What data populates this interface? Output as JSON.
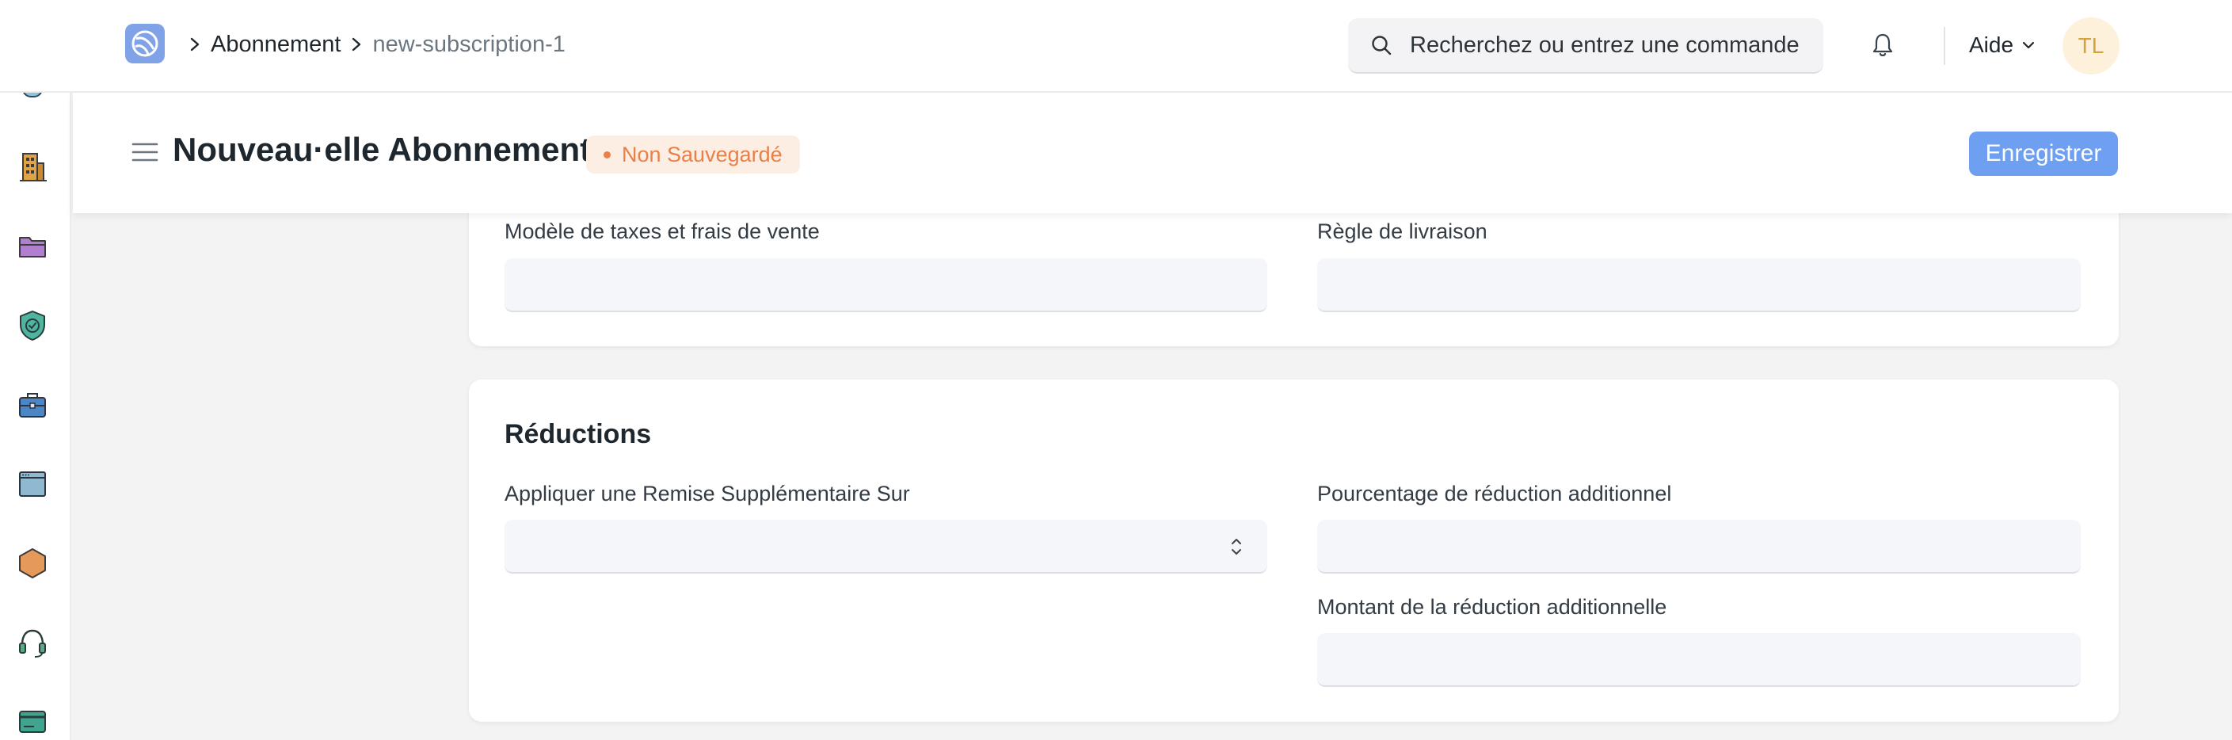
{
  "navbar": {
    "breadcrumbs": [
      "Abonnement",
      "new-subscription-1"
    ],
    "search_placeholder": "Recherchez ou entrez une commande",
    "help_label": "Aide",
    "avatar_initials": "TL"
  },
  "sidebar": {
    "icons": [
      "database-icon",
      "building-icon",
      "folder-icon",
      "shield-check-icon",
      "briefcase-icon",
      "window-icon",
      "hexagon-icon",
      "headset-icon",
      "card-icon"
    ]
  },
  "page": {
    "title": "Nouveau·elle Abonnement",
    "status": "Non Sauvegardé",
    "save_label": "Enregistrer"
  },
  "taxes_section": {
    "tax_template_label": "Modèle de taxes et frais de vente",
    "tax_template_value": "",
    "shipping_rule_label": "Règle de livraison",
    "shipping_rule_value": ""
  },
  "discounts_section": {
    "title": "Réductions",
    "apply_discount_on_label": "Appliquer une Remise Supplémentaire Sur",
    "apply_discount_on_value": "",
    "additional_discount_percentage_label": "Pourcentage de réduction additionnel",
    "additional_discount_percentage_value": "",
    "discount_amount_label": "Montant de la réduction additionnelle",
    "discount_amount_value": ""
  },
  "colors": {
    "primary": "#6e9ff0",
    "status_orange": "#e8804a",
    "avatar_bg": "#fdf1dc"
  }
}
